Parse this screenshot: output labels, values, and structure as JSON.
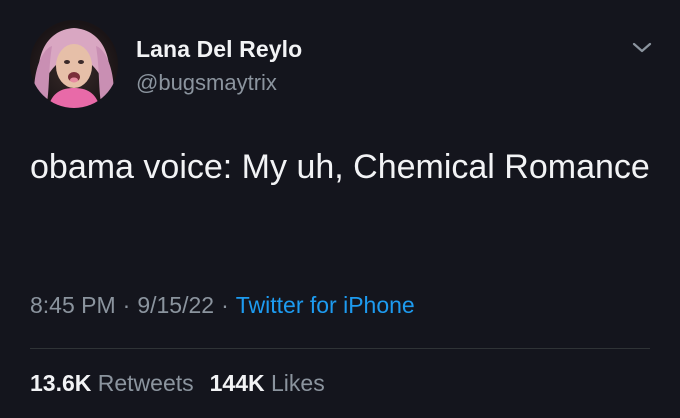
{
  "author": {
    "display_name": "Lana Del Reylo",
    "handle": "@bugsmaytrix",
    "avatar_icon": "profile-photo"
  },
  "tweet": {
    "text": "obama voice: My uh, Chemical Romance",
    "time": "8:45 PM",
    "date": "9/15/22",
    "source": "Twitter for iPhone",
    "separator": "·"
  },
  "stats": {
    "retweets_count": "13.6K",
    "retweets_label": "Retweets",
    "likes_count": "144K",
    "likes_label": "Likes"
  },
  "colors": {
    "background": "#14151d",
    "link": "#1d9bf0",
    "muted_text": "#8b949e",
    "primary_text": "#f2f3f5"
  }
}
